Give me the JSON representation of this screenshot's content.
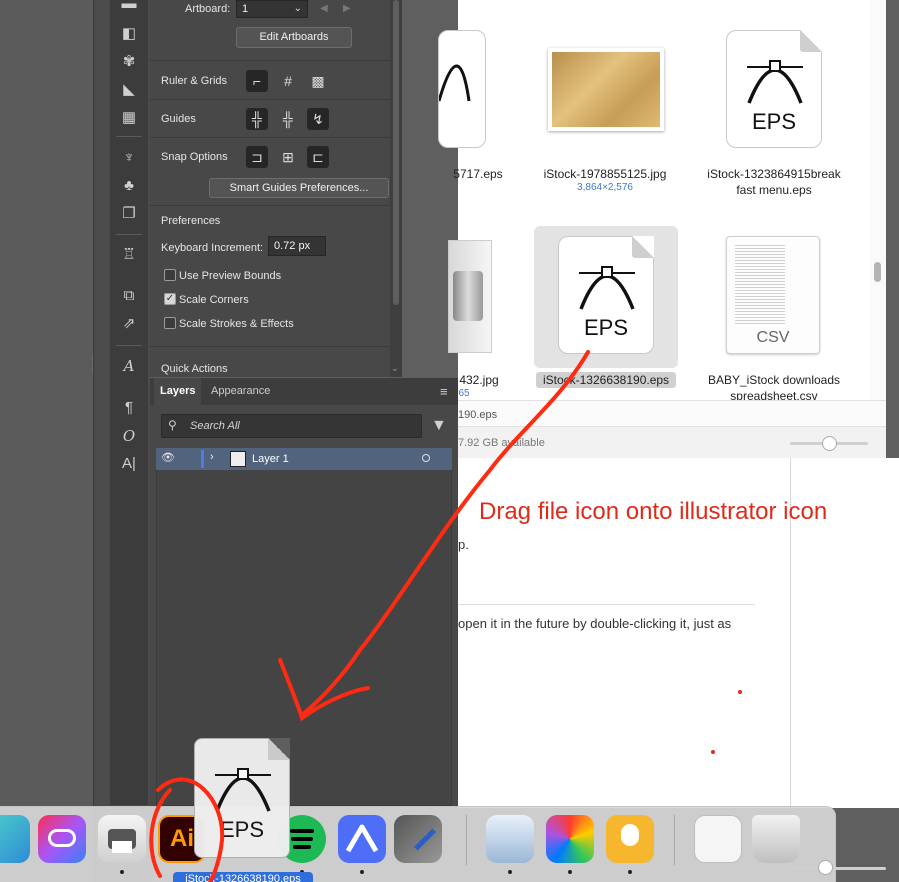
{
  "illustrator": {
    "properties": {
      "artboard_label": "Artboard:",
      "artboard_value": "1",
      "edit_artboards": "Edit Artboards",
      "ruler_grids": "Ruler & Grids",
      "guides": "Guides",
      "snap_options": "Snap Options",
      "smart_guides": "Smart Guides Preferences...",
      "preferences": "Preferences",
      "keyboard_increment_label": "Keyboard Increment:",
      "keyboard_increment_value": "0.72 px",
      "use_preview_bounds": "Use Preview Bounds",
      "scale_corners": "Scale Corners",
      "scale_strokes": "Scale Strokes & Effects",
      "quick_actions": "Quick Actions"
    },
    "layers_panel": {
      "tabs": [
        "Layers",
        "Appearance"
      ],
      "search_placeholder": "Search All",
      "layer_name": "Layer 1"
    }
  },
  "finder": {
    "files": [
      {
        "name": "5717.eps"
      },
      {
        "name": "iStock-1978855125.jpg",
        "dims": "3,864×2,576"
      },
      {
        "name_line1": "iStock-1323864915break",
        "name_line2": "fast menu.eps"
      },
      {
        "name": "432.jpg",
        "sub": "65"
      },
      {
        "name": "iStock-1326638190.eps"
      },
      {
        "name_line1": "BABY_iStock downloads",
        "name_line2": "spreadsheet.csv"
      }
    ],
    "eps_badge": "EPS",
    "csv_badge": "CSV",
    "path_fragment": "190.eps",
    "status": "7.92 GB available"
  },
  "document": {
    "annotation": "Drag file icon onto illustrator icon",
    "line1_fragment": "p.",
    "line2_fragment": "open it in the future by double-clicking it, just as"
  },
  "dock": {
    "illustrator_label": "Ai",
    "drag_label": "iStock-1326638190.eps",
    "drag_badge": "EPS"
  },
  "colors": {
    "annotation_red": "#e02b1a",
    "selection_blue": "#2f6fdb",
    "ai_orange": "#ff9a00"
  }
}
